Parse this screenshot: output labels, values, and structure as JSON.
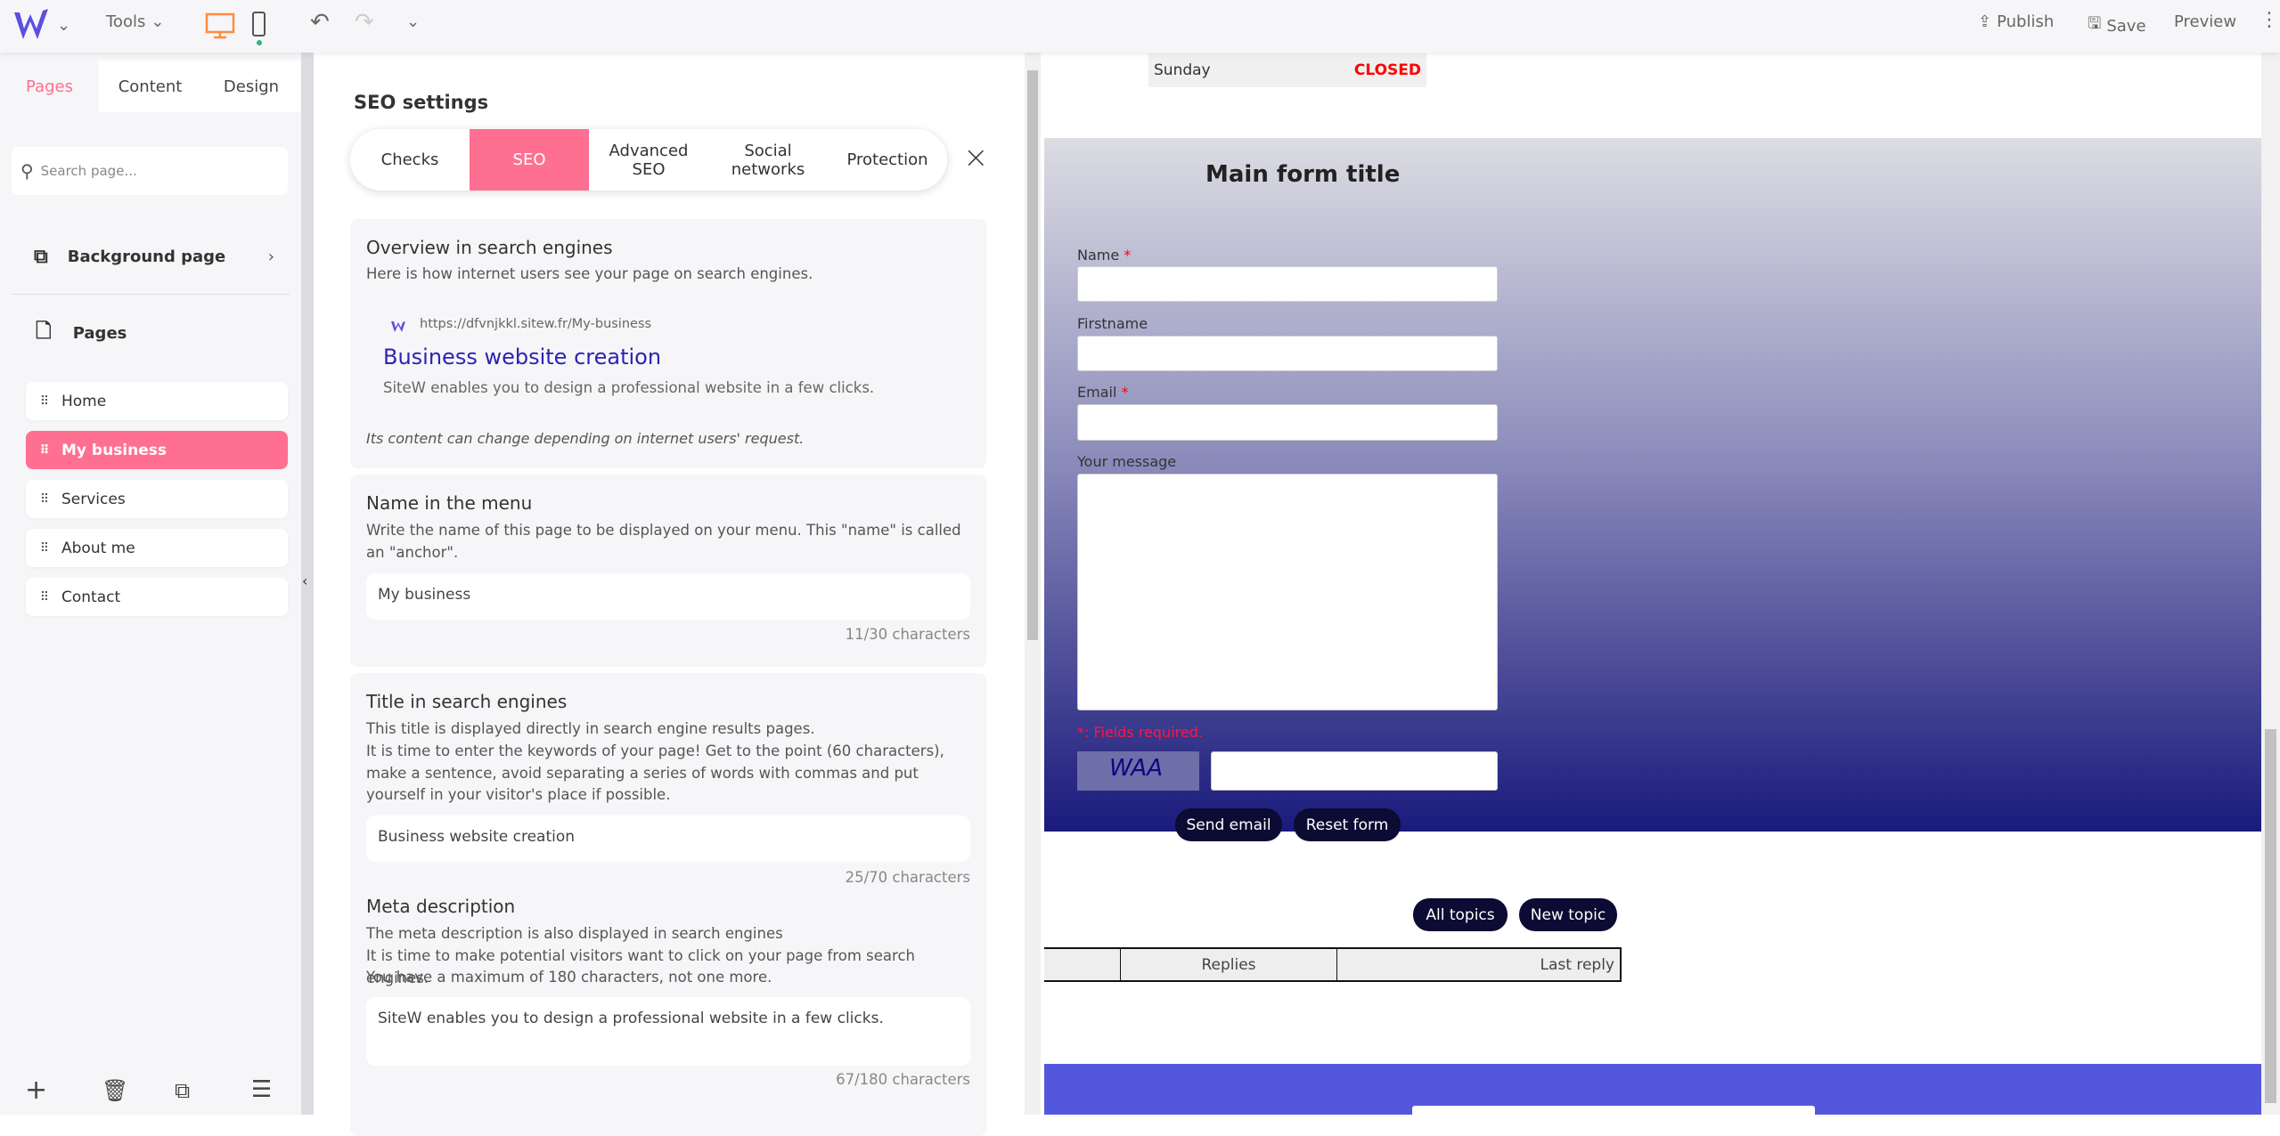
{
  "topbar": {
    "tools": "Tools",
    "publish": "Publish",
    "save": "Save",
    "preview": "Preview"
  },
  "left": {
    "tabs": [
      "Pages",
      "Content",
      "Design"
    ],
    "search_placeholder": "Search page...",
    "background_page": "Background page",
    "pages_heading": "Pages",
    "pages": [
      {
        "label": "Home"
      },
      {
        "label": "My business",
        "active": true
      },
      {
        "label": "Services"
      },
      {
        "label": "About me"
      },
      {
        "label": "Contact"
      }
    ]
  },
  "seo": {
    "title": "SEO settings",
    "tabs": [
      "Checks",
      "SEO",
      "Advanced SEO",
      "Social networks",
      "Protection"
    ],
    "active_tab": "SEO",
    "overview": {
      "title": "Overview in search engines",
      "desc": "Here is how internet users see your page on search engines.",
      "url": "https://dfvnjkkl.sitew.fr/My-business",
      "result_title": "Business website creation",
      "result_desc": "SiteW enables you to design a professional website in a few clicks.",
      "note": "Its content can change depending on internet users' request."
    },
    "menu_name": {
      "title": "Name in the menu",
      "desc": "Write the name of this page to be displayed on your menu. This \"name\" is called an \"anchor\".",
      "value": "My business",
      "count": "11/30 characters"
    },
    "search_title": {
      "title": "Title in search engines",
      "desc1": "This title is displayed directly in search engine results pages.",
      "desc2": "It is time to enter the keywords of your page! Get to the point (60 characters), make a sentence, avoid separating a series of words with commas and put yourself in your visitor's place if possible.",
      "value": "Business website creation",
      "count": "25/70 characters"
    },
    "meta": {
      "title": "Meta description",
      "desc1": "The meta description is also displayed in search engines",
      "desc2": "It is time to make potential visitors want to click on your page from search engines.",
      "desc3": "You have a maximum of 180 characters, not one more.",
      "value": "SiteW enables you to design a professional website in a few clicks.",
      "count": "67/180 characters"
    }
  },
  "preview": {
    "hours": {
      "day": "Sunday",
      "status": "CLOSED"
    },
    "form": {
      "title": "Main form title",
      "name": "Name",
      "firstname": "Firstname",
      "email": "Email",
      "message": "Your message",
      "required_mark": "*",
      "required_note": "*: Fields required.",
      "captcha": "WAA",
      "send": "Send email",
      "reset": "Reset form"
    },
    "forum": {
      "all_topics": "All topics",
      "new_topic": "New topic",
      "columns": [
        "",
        "Replies",
        "Last reply"
      ]
    }
  },
  "colors": {
    "accent": "#ff6f91",
    "brand": "#5a4fe0",
    "dark_button": "#0b0b33",
    "footer": "#5457de",
    "closed": "#ff0000"
  }
}
